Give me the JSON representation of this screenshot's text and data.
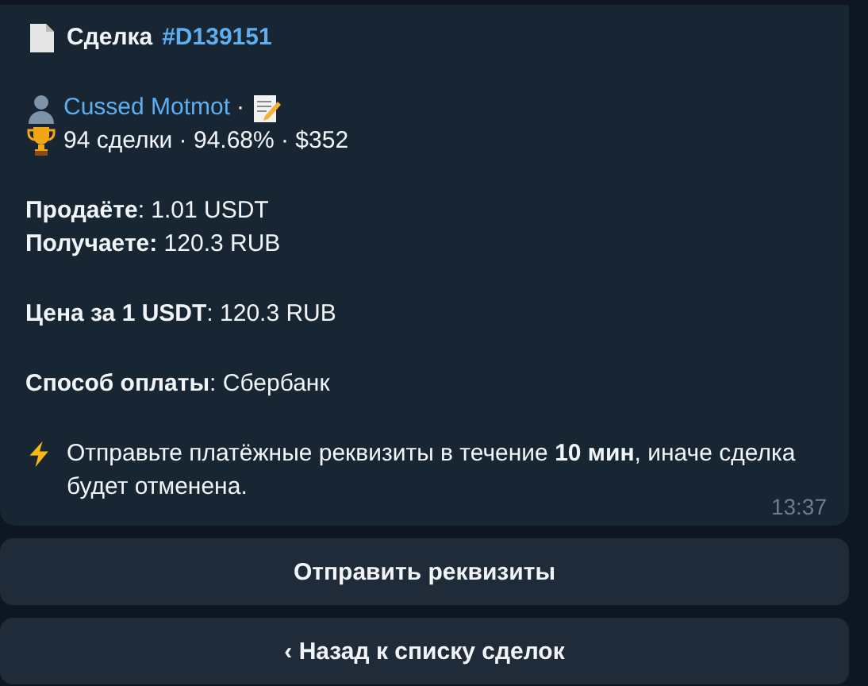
{
  "message": {
    "title": {
      "label": "Сделка",
      "tag": "#D139151"
    },
    "seller": {
      "name": "Cussed Motmot",
      "separator": "·"
    },
    "stats": "94 сделки · 94.68% · $352",
    "details": [
      [
        "**Продаёте**: 1.01 USDT",
        "**Получаете:** 120.3 RUB"
      ],
      [
        "**Цена за 1 USDT**: 120.3 RUB"
      ],
      [
        "**Способ оплаты**: Сбербанк"
      ]
    ],
    "notice": "Отправьте платёжные реквизиты в течение **10 мин**, иначе сделка будет отменена.",
    "time": "13:37"
  },
  "buttons": [
    "Отправить реквизиты",
    "‹ Назад к списку сделок"
  ]
}
